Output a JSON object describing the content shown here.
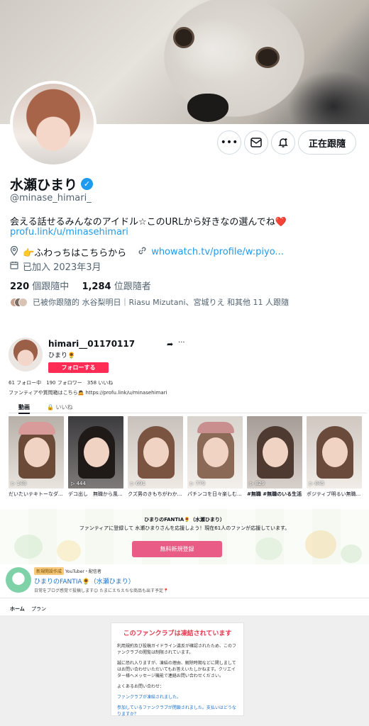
{
  "twitter": {
    "name": "水瀬ひまり",
    "handle": "@minase_himari_",
    "bio": "会える話せるみんなのアイドル☆このURLから好きなの選んでね❤️",
    "bio_link": "profu.link/u/minasehimari",
    "location": "👉ふわっちはこちらから",
    "website": "whowatch.tv/profile/w:piyo...",
    "joined": "已加入 2023年3月",
    "following_count": "220",
    "following_label": "個跟隨中",
    "followers_count": "1,284",
    "followers_label": "位跟隨者",
    "followed_by": "已被你跟隨的 水谷梨明日｜Riasu Mizutani、宮城りえ 和其他 11 人跟隨",
    "follow_button": "正在跟隨",
    "more_icon": "more-icon",
    "mail_icon": "mail-icon",
    "notify_icon": "notification-bell-icon",
    "accent": "#1d9bf0"
  },
  "tiktok": {
    "username": "himari__01170117",
    "display_name": "ひまり🌻",
    "follow_button": "フォローする",
    "stats": "61 フォロー中　190 フォロワー　358 いいね",
    "bio": "ファンティアや質問箱はこちら🙇 https://profu.link/u/minasehimari",
    "tabs": [
      "動画",
      "🔒 いいね"
    ],
    "videos": [
      {
        "views": "▷ 148",
        "caption": "だいたいテキトーなダ..."
      },
      {
        "views": "▷ 444",
        "caption": "デコ出し　無職から風..."
      },
      {
        "views": "▷ 691",
        "caption": "クズ男のきもちがわか..."
      },
      {
        "views": "▷ 779",
        "caption": "パチンコを日々楽しむ..."
      },
      {
        "views": "▷ 829",
        "caption": "#無職 #無職のいる生活..."
      },
      {
        "views": "▷ 845",
        "caption": "ポジティブ明るい無職..."
      }
    ],
    "accent": "#fe2c55"
  },
  "fantia": {
    "banner_title": "ひまりのFANTIA🌻（水瀬ひまり）",
    "banner_desc": "ファンティアに登録して 水瀬ひまりさんを応援しよう！現在61人のファンが応援しています。",
    "register_button": "無料新規登録",
    "badge_new": "新規開設作成",
    "badge_category": "YouTuber・配信者",
    "club_name": "ひまりのFANTIA🌻（水瀬ひまり）",
    "club_sub": "日常をブログ感覚で投稿します😊 たまにえちえちな商品も出す予定📍",
    "tabs": [
      "ホーム",
      "プラン"
    ],
    "notice_title": "このファンクラブは凍結されています",
    "notice_p1": "利用規約及び投稿ガイドライン違反が確認されたため、このファンクラブの閲覧は制限されています。",
    "notice_p2": "誠に恐れ入りますが、凍結の理由、解除時期などに関しましてはお問い合わせいただいてもお答えいたしかねます。クリエイター様へメッセージ機能で連絡お問い合わせください。",
    "faq_label": "よくあるお問い合わせ：",
    "faq1": "ファンクラブが凍結されました。",
    "faq2": "参加しているファンクラブが閉鎖されました。支払いはどうなりますか？",
    "accent": "#e95c86"
  }
}
